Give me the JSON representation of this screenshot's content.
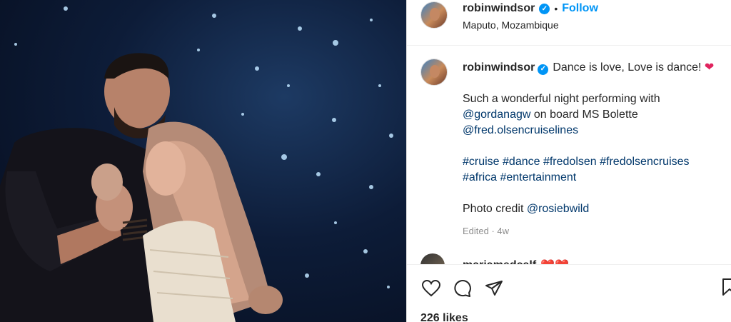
{
  "post": {
    "username": "robinwindsor",
    "follow_label": "Follow",
    "separator": "•",
    "location": "Maputo, Mozambique"
  },
  "caption": {
    "username": "robinwindsor",
    "line1": "Dance is love, Love is dance!",
    "line2": "Such a wonderful night performing with",
    "mention1": "@gordanagw",
    "line3_tail": " on board MS Bolette",
    "mention2": "@fred.olsencruiselines",
    "hashtags1": "#cruise #dance #fredolsen #fredolsencruises",
    "hashtags2": "#africa #entertainment",
    "credit_label": "Photo credit ",
    "credit_mention": "@rosiebwild",
    "edited": "Edited · 4w"
  },
  "comment": {
    "username": "mariamedcalf",
    "hearts": "❤️❤️"
  },
  "footer": {
    "likes": "226 likes"
  },
  "icons": {
    "like": "heart-icon",
    "comment": "comment-icon",
    "share": "share-icon",
    "save": "bookmark-icon",
    "verified": "verified-badge-icon"
  },
  "colors": {
    "accent": "#0095f6",
    "link": "#00376b",
    "heart": "#e0245e"
  }
}
